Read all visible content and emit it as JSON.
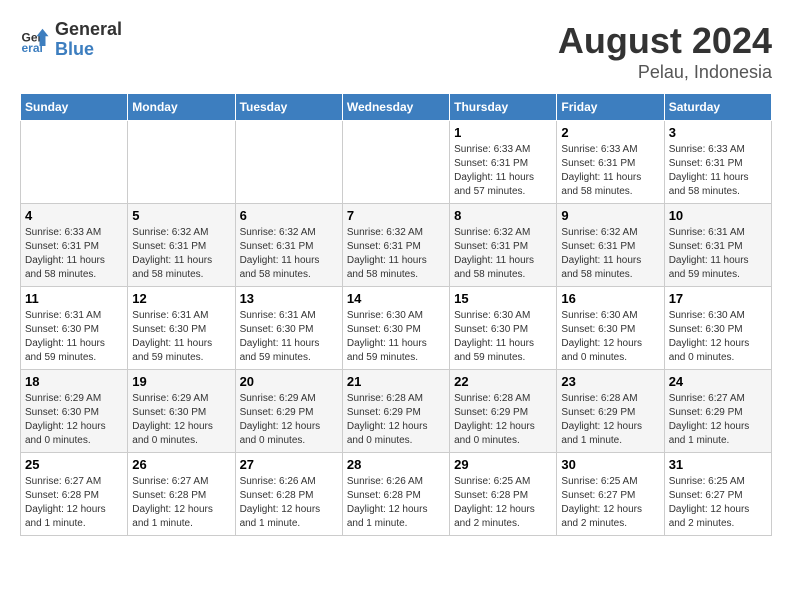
{
  "logo": {
    "line1": "General",
    "line2": "Blue"
  },
  "title": "August 2024",
  "subtitle": "Pelau, Indonesia",
  "weekdays": [
    "Sunday",
    "Monday",
    "Tuesday",
    "Wednesday",
    "Thursday",
    "Friday",
    "Saturday"
  ],
  "weeks": [
    [
      {
        "day": "",
        "info": ""
      },
      {
        "day": "",
        "info": ""
      },
      {
        "day": "",
        "info": ""
      },
      {
        "day": "",
        "info": ""
      },
      {
        "day": "1",
        "info": "Sunrise: 6:33 AM\nSunset: 6:31 PM\nDaylight: 11 hours\nand 57 minutes."
      },
      {
        "day": "2",
        "info": "Sunrise: 6:33 AM\nSunset: 6:31 PM\nDaylight: 11 hours\nand 58 minutes."
      },
      {
        "day": "3",
        "info": "Sunrise: 6:33 AM\nSunset: 6:31 PM\nDaylight: 11 hours\nand 58 minutes."
      }
    ],
    [
      {
        "day": "4",
        "info": "Sunrise: 6:33 AM\nSunset: 6:31 PM\nDaylight: 11 hours\nand 58 minutes."
      },
      {
        "day": "5",
        "info": "Sunrise: 6:32 AM\nSunset: 6:31 PM\nDaylight: 11 hours\nand 58 minutes."
      },
      {
        "day": "6",
        "info": "Sunrise: 6:32 AM\nSunset: 6:31 PM\nDaylight: 11 hours\nand 58 minutes."
      },
      {
        "day": "7",
        "info": "Sunrise: 6:32 AM\nSunset: 6:31 PM\nDaylight: 11 hours\nand 58 minutes."
      },
      {
        "day": "8",
        "info": "Sunrise: 6:32 AM\nSunset: 6:31 PM\nDaylight: 11 hours\nand 58 minutes."
      },
      {
        "day": "9",
        "info": "Sunrise: 6:32 AM\nSunset: 6:31 PM\nDaylight: 11 hours\nand 58 minutes."
      },
      {
        "day": "10",
        "info": "Sunrise: 6:31 AM\nSunset: 6:31 PM\nDaylight: 11 hours\nand 59 minutes."
      }
    ],
    [
      {
        "day": "11",
        "info": "Sunrise: 6:31 AM\nSunset: 6:30 PM\nDaylight: 11 hours\nand 59 minutes."
      },
      {
        "day": "12",
        "info": "Sunrise: 6:31 AM\nSunset: 6:30 PM\nDaylight: 11 hours\nand 59 minutes."
      },
      {
        "day": "13",
        "info": "Sunrise: 6:31 AM\nSunset: 6:30 PM\nDaylight: 11 hours\nand 59 minutes."
      },
      {
        "day": "14",
        "info": "Sunrise: 6:30 AM\nSunset: 6:30 PM\nDaylight: 11 hours\nand 59 minutes."
      },
      {
        "day": "15",
        "info": "Sunrise: 6:30 AM\nSunset: 6:30 PM\nDaylight: 11 hours\nand 59 minutes."
      },
      {
        "day": "16",
        "info": "Sunrise: 6:30 AM\nSunset: 6:30 PM\nDaylight: 12 hours\nand 0 minutes."
      },
      {
        "day": "17",
        "info": "Sunrise: 6:30 AM\nSunset: 6:30 PM\nDaylight: 12 hours\nand 0 minutes."
      }
    ],
    [
      {
        "day": "18",
        "info": "Sunrise: 6:29 AM\nSunset: 6:30 PM\nDaylight: 12 hours\nand 0 minutes."
      },
      {
        "day": "19",
        "info": "Sunrise: 6:29 AM\nSunset: 6:30 PM\nDaylight: 12 hours\nand 0 minutes."
      },
      {
        "day": "20",
        "info": "Sunrise: 6:29 AM\nSunset: 6:29 PM\nDaylight: 12 hours\nand 0 minutes."
      },
      {
        "day": "21",
        "info": "Sunrise: 6:28 AM\nSunset: 6:29 PM\nDaylight: 12 hours\nand 0 minutes."
      },
      {
        "day": "22",
        "info": "Sunrise: 6:28 AM\nSunset: 6:29 PM\nDaylight: 12 hours\nand 0 minutes."
      },
      {
        "day": "23",
        "info": "Sunrise: 6:28 AM\nSunset: 6:29 PM\nDaylight: 12 hours\nand 1 minute."
      },
      {
        "day": "24",
        "info": "Sunrise: 6:27 AM\nSunset: 6:29 PM\nDaylight: 12 hours\nand 1 minute."
      }
    ],
    [
      {
        "day": "25",
        "info": "Sunrise: 6:27 AM\nSunset: 6:28 PM\nDaylight: 12 hours\nand 1 minute."
      },
      {
        "day": "26",
        "info": "Sunrise: 6:27 AM\nSunset: 6:28 PM\nDaylight: 12 hours\nand 1 minute."
      },
      {
        "day": "27",
        "info": "Sunrise: 6:26 AM\nSunset: 6:28 PM\nDaylight: 12 hours\nand 1 minute."
      },
      {
        "day": "28",
        "info": "Sunrise: 6:26 AM\nSunset: 6:28 PM\nDaylight: 12 hours\nand 1 minute."
      },
      {
        "day": "29",
        "info": "Sunrise: 6:25 AM\nSunset: 6:28 PM\nDaylight: 12 hours\nand 2 minutes."
      },
      {
        "day": "30",
        "info": "Sunrise: 6:25 AM\nSunset: 6:27 PM\nDaylight: 12 hours\nand 2 minutes."
      },
      {
        "day": "31",
        "info": "Sunrise: 6:25 AM\nSunset: 6:27 PM\nDaylight: 12 hours\nand 2 minutes."
      }
    ]
  ]
}
